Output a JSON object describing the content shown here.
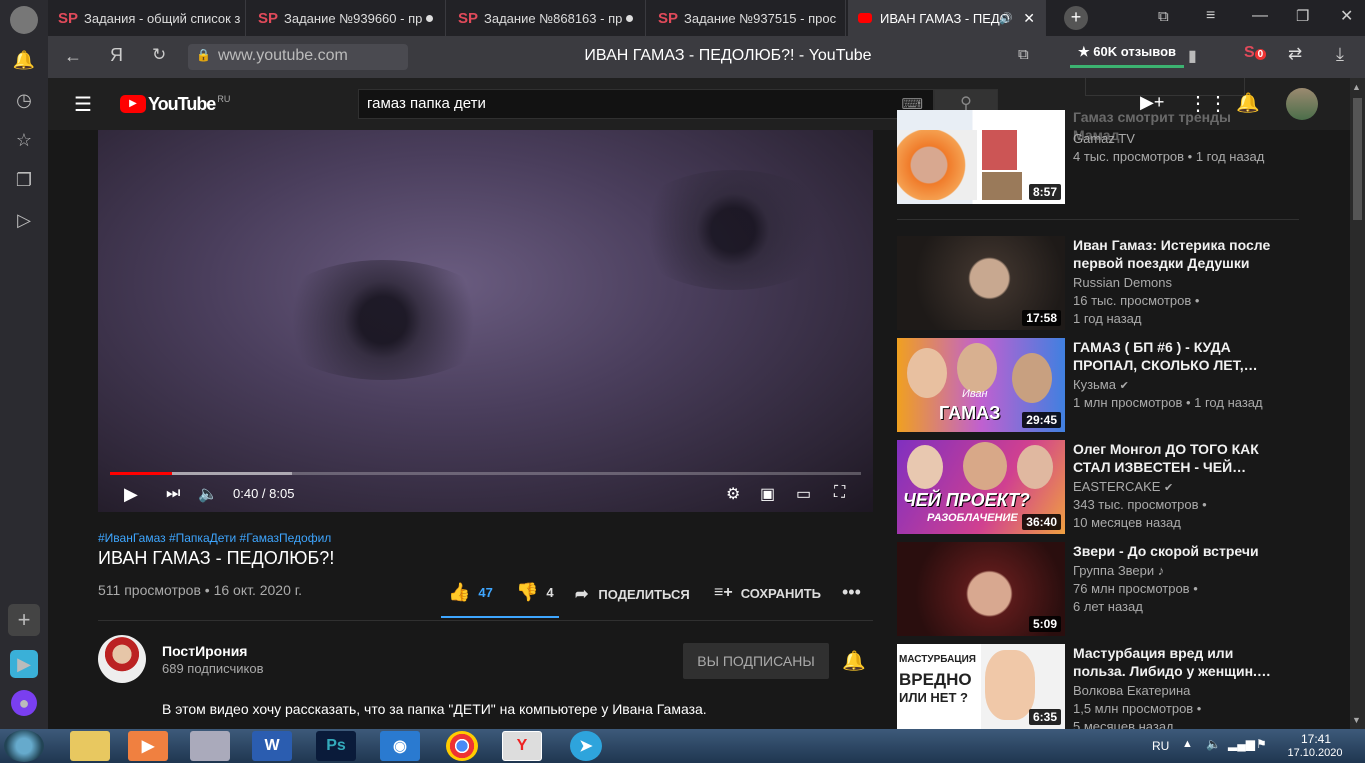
{
  "browser": {
    "tabs": [
      {
        "title": "Задания - общий список з"
      },
      {
        "title": "Задание №939660 - пр"
      },
      {
        "title": "Задание №868163 - пр"
      },
      {
        "title": "Задание №937515 - прос"
      },
      {
        "title": "ИВАН ГАМАЗ - ПЕДО"
      }
    ],
    "url": "www.youtube.com",
    "page_title": "ИВАН ГАМАЗ - ПЕДОЛЮБ?! - YouTube",
    "reviews": "60K отзывов",
    "badge_count": "0",
    "tab_favicon": "SP",
    "yandex_letter": "Я"
  },
  "youtube": {
    "logo": "YouTube",
    "region": "RU",
    "search_value": "гамаз папка дети",
    "video": {
      "time": "0:40 / 8:05",
      "progress": 0.083,
      "tags": "#ИванГамаз #ПапкаДети #ГамазПедофил",
      "title": "ИВАН ГАМАЗ - ПЕДОЛЮБ?!",
      "meta": "511 просмотров • 16 окт. 2020 г.",
      "likes": "47",
      "dislikes": "4",
      "share": "ПОДЕЛИТЬСЯ",
      "save": "СОХРАНИТЬ"
    },
    "channel": {
      "name": "ПостИрония",
      "subs": "689 подписчиков",
      "subscribed_label": "ВЫ ПОДПИСАНЫ",
      "description": "В этом видео хочу рассказать, что за папка \"ДЕТИ\" на компьютере у Ивана Гамаза."
    },
    "sidebar": [
      {
        "title": "Гамаз смотрит тренды Мамад",
        "channel": "Gamaz TV",
        "line1": "4 тыс. просмотров • 1 год назад",
        "line2": "",
        "duration": "8:57"
      },
      {
        "title": "Иван Гамаз: Истерика после первой поездки Дедушки",
        "channel": "Russian Demons",
        "line1": "16 тыс. просмотров •",
        "line2": "1 год назад",
        "duration": "17:58"
      },
      {
        "title": "ГАМАЗ ( БП #6 ) - КУДА ПРОПАЛ, СКОЛЬКО ЛЕТ,…",
        "channel": "Кузьма",
        "line1": "1 млн просмотров • 1 год назад",
        "line2": "",
        "duration": "29:45",
        "thumb_text": "ГАМАЗ",
        "thumb_script": "Иван"
      },
      {
        "title": "Олег Монгол ДО ТОГО КАК СТАЛ ИЗВЕСТЕН - ЧЕЙ…",
        "channel": "EASTERCAKE",
        "line1": "343 тыс. просмотров •",
        "line2": "10 месяцев назад",
        "duration": "36:40",
        "thumb_text": "ЧЕЙ ПРОЕКТ?",
        "thumb_text2": "РАЗОБЛАЧЕНИЕ"
      },
      {
        "title": "Звери - До скорой встречи",
        "channel": "Группа Звери",
        "line1": "76 млн просмотров •",
        "line2": "6 лет назад",
        "duration": "5:09"
      },
      {
        "title": "Мастурбация вред или польза. Либидо у женщин.…",
        "channel": "Волкова Екатерина",
        "line1": "1,5 млн просмотров •",
        "line2": "5 месяцев назад",
        "duration": "6:35",
        "thumb_text": "МАСТУРБАЦИЯ",
        "thumb_text2": "ВРЕДНО",
        "thumb_text3": "ИЛИ НЕТ ?"
      }
    ]
  },
  "taskbar": {
    "lang": "RU",
    "time": "17:41",
    "date": "17.10.2020",
    "app_word": "W",
    "app_ps": "Ps",
    "app_yandex": "Y"
  },
  "colors": {
    "accent": "#3ea6ff",
    "red": "#ff0000",
    "bg": "#181818"
  }
}
